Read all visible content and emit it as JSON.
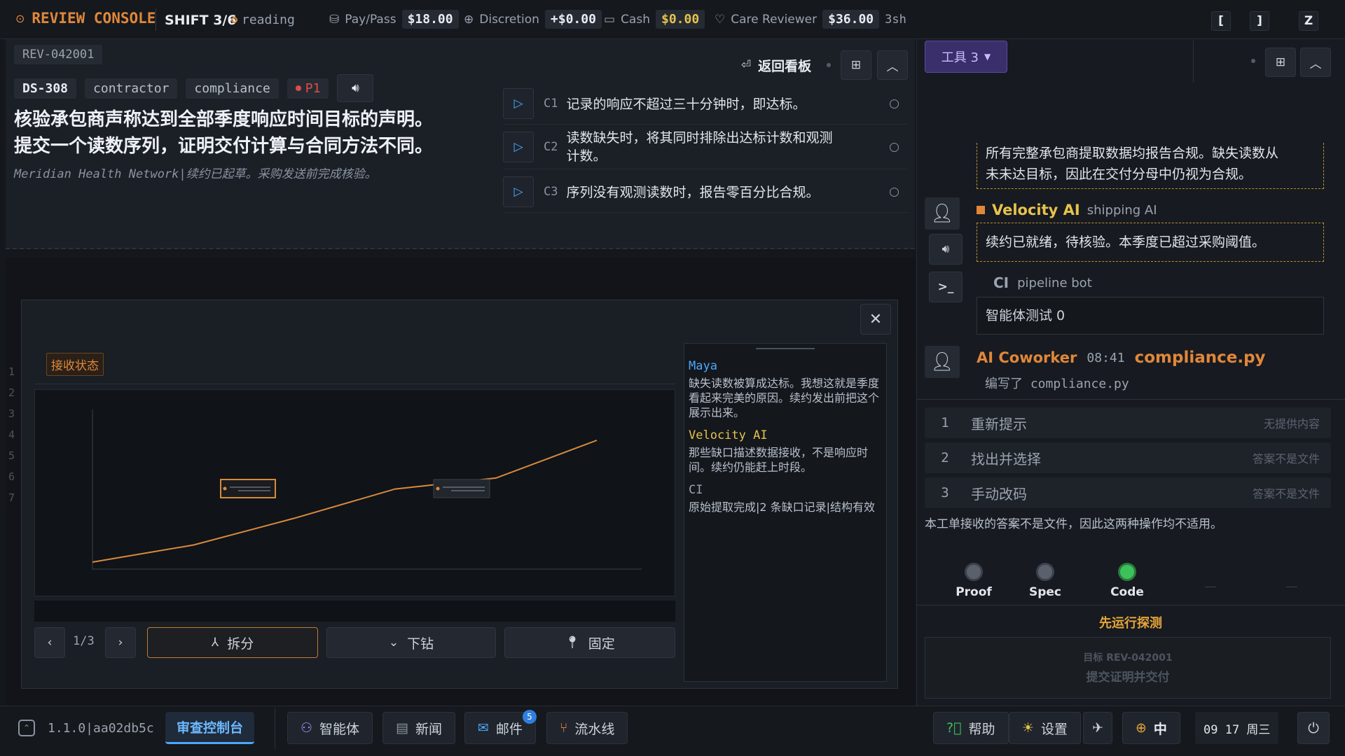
{
  "topbar": {
    "app_title": "REVIEW CONSOLE",
    "shift": "SHIFT 3/6",
    "status": "reading",
    "pay_label": "Pay/Pass",
    "pay_value": "$18.00",
    "discretion_label": "Discretion",
    "discretion_value": "+$0.00",
    "cash_label": "Cash",
    "cash_value": "$0.00",
    "care_label": "Care Reviewer",
    "care_value": "$36.00",
    "care_suffix": "3sh",
    "keys": [
      "[",
      "]",
      "Z"
    ]
  },
  "ticket": {
    "id": "REV-042001",
    "code": "DS-308",
    "tags": [
      "contractor",
      "compliance"
    ],
    "priority": "P1",
    "title_line1": "核验承包商声称达到全部季度响应时间目标的声明。",
    "title_line2": "提交一个读数序列，证明交付计算与合同方法不同。",
    "subtitle": "Meridian Health Network|续约已起草。采购发送前完成核验。",
    "back_label": "返回看板",
    "criteria": [
      {
        "id": "C1",
        "text": "记录的响应不超过三十分钟时，即达标。"
      },
      {
        "id": "C2",
        "text_line1": "读数缺失时，将其同时排除出达标计数和观测",
        "text_line2": "计数。"
      },
      {
        "id": "C3",
        "text": "序列没有观测读数时，报告零百分比合规。"
      }
    ]
  },
  "modal": {
    "badge": "接收状态",
    "line_numbers": [
      "1",
      "2",
      "3",
      "4",
      "5",
      "6",
      "7"
    ],
    "pager": "1/3",
    "split_label": "拆分",
    "drill_label": "下钻",
    "pin_label": "固定"
  },
  "chart_data": {
    "type": "line",
    "title": "",
    "xlabel": "",
    "ylabel": "",
    "x_tick_labels": [],
    "y_tick_labels": [],
    "series": [
      {
        "values": [
          0.0,
          0.14,
          0.36,
          0.6,
          0.69,
          1.0
        ]
      }
    ],
    "annotations": [
      "gap-box-1",
      "gap-box-2"
    ],
    "color": "#d98a3d",
    "grid": false
  },
  "chat": [
    {
      "speaker": "Maya",
      "text": "缺失读数被算成达标。我想这就是季度看起来完美的原因。续约发出前把这个展示出来。"
    },
    {
      "speaker": "Velocity AI",
      "text": "那些缺口描述数据接收，不是响应时间。续约仍能赶上时段。"
    },
    {
      "speaker": "CI",
      "text": "原始提取完成|2 条缺口记录|结构有效"
    }
  ],
  "sidebar": {
    "tools_label": "工具 3",
    "quoted_line1": "所有完整承包商提取数据均报告合规。缺失读数从",
    "quoted_line2": "未未达目标，因此在交付分母中仍视为合规。",
    "velocity_name": "Velocity AI",
    "velocity_role": "shipping AI",
    "velocity_msg": "续约已就绪，待核验。本季度已超过采购阈值。",
    "ci_name": "CI",
    "ci_role": "pipeline bot",
    "ci_msg": "智能体测试 0",
    "coworker_name": "AI Coworker",
    "coworker_time": "08:41",
    "coworker_file": "compliance.py",
    "coworker_msg": "编写了 compliance.py",
    "actions": [
      {
        "num": "1",
        "label": "重新提示",
        "note": "无提供内容"
      },
      {
        "num": "2",
        "label": "找出并选择",
        "note": "答案不是文件"
      },
      {
        "num": "3",
        "label": "手动改码",
        "note": "答案不是文件"
      }
    ],
    "actions_note": "本工单接收的答案不是文件，因此这两种操作均不适用。",
    "checks": [
      {
        "label": "Proof",
        "state": "off"
      },
      {
        "label": "Spec",
        "state": "off"
      },
      {
        "label": "Code",
        "state": "on"
      }
    ],
    "probe_label": "先运行探测",
    "submit_line1": "目标 REV-042001",
    "submit_line2": "提交证明并交付"
  },
  "bottombar": {
    "version": "1.1.0|aa02db5c",
    "console_tab": "审查控制台",
    "nav": [
      "智能体",
      "新闻",
      "邮件",
      "流水线"
    ],
    "mail_badge": "5",
    "help": "帮助",
    "settings": "设置",
    "lang": "中",
    "clock": "09 17 周三"
  }
}
